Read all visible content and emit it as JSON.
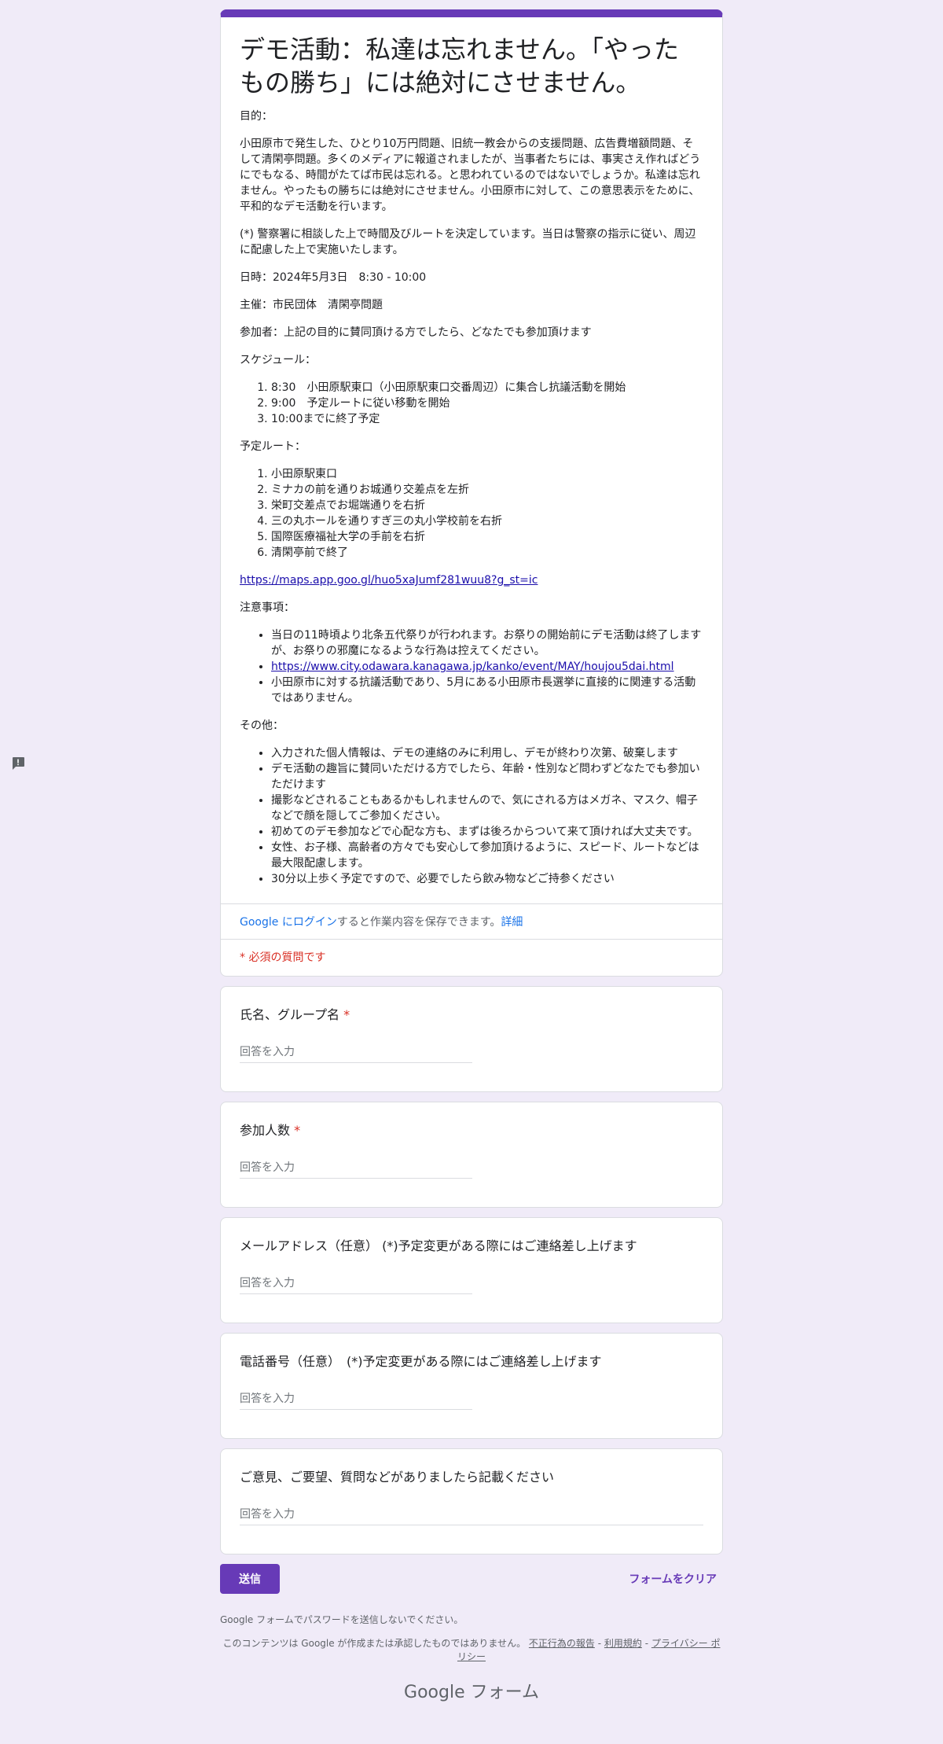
{
  "form": {
    "title": "デモ活動：私達は忘れません。「やったもの勝ち」には絶対にさせません。",
    "accent": "#673ab7",
    "purpose_heading": "目的：",
    "purpose_text": "小田原市で発生した、ひとり10万円問題、旧統一教会からの支援問題、広告費増額問題、そして清閑亭問題。多くのメディアに報道されましたが、当事者たちには、事実さえ作ればどうにでもなる、時間がたてば市民は忘れる。と思われているのではないでしょうか。私達は忘れません。やったもの勝ちには絶対にさせません。小田原市に対して、この意思表示をために、平和的なデモ活動を行います。",
    "police_note": "(*) 警察署に相談した上で時間及びルートを決定しています。当日は警察の指示に従い、周辺に配慮した上で実施いたします。",
    "datetime": "日時：2024年5月3日　8:30 - 10:00",
    "organizer": "主催：市民団体　清閑亭問題",
    "participants": "参加者：上記の目的に賛同頂ける方でしたら、どなたでも参加頂けます",
    "schedule_heading": "スケジュール：",
    "schedule": [
      "8:30　小田原駅東口（小田原駅東口交番周辺）に集合し抗議活動を開始",
      "9:00　予定ルートに従い移動を開始",
      "10:00までに終了予定"
    ],
    "route_heading": "予定ルート：",
    "route": [
      "小田原駅東口",
      "ミナカの前を通りお城通り交差点を左折",
      "栄町交差点でお堀端通りを右折",
      "三の丸ホールを通りすぎ三の丸小学校前を右折",
      "国際医療福祉大学の手前を右折",
      "清閑亭前で終了"
    ],
    "map_link": "https://maps.app.goo.gl/huo5xaJumf281wuu8?g_st=ic",
    "notes_heading": "注意事項：",
    "notes": [
      {
        "text": "当日の11時頃より北条五代祭りが行われます。お祭りの開始前にデモ活動は終了しますが、お祭りの邪魔になるような行為は控えてください。",
        "link": false
      },
      {
        "text": "https://www.city.odawara.kanagawa.jp/kanko/event/MAY/houjou5dai.html",
        "link": true
      },
      {
        "text": "小田原市に対する抗議活動であり、5月にある小田原市長選挙に直接的に関連する活動ではありません。",
        "link": false
      }
    ],
    "other_heading": "その他：",
    "other": [
      "入力された個人情報は、デモの連絡のみに利用し、デモが終わり次第、破棄します",
      "デモ活動の趣旨に賛同いただける方でしたら、年齢・性別など問わずどなたでも参加いただけます",
      "撮影などされることもあるかもしれませんので、気にされる方はメガネ、マスク、帽子などで顔を隠してご参加ください。",
      "初めてのデモ参加などで心配な方も、まずは後ろからついて来て頂ければ大丈夫です。",
      "女性、お子様、高齢者の方々でも安心して参加頂けるように、スピード、ルートなどは最大限配慮します。",
      "30分以上歩く予定ですので、必要でしたら飲み物などご持参ください"
    ],
    "login_link": "Google にログイン",
    "login_text": "すると作業内容を保存できます。",
    "login_more": "詳細",
    "required_note": "* 必須の質問です"
  },
  "questions": [
    {
      "label": "氏名、グループ名",
      "required": true,
      "placeholder": "回答を入力"
    },
    {
      "label": "参加人数",
      "required": true,
      "placeholder": "回答を入力"
    },
    {
      "label": "メールアドレス（任意） (*)予定変更がある際にはご連絡差し上げます",
      "required": false,
      "placeholder": "回答を入力"
    },
    {
      "label": "電話番号（任意）　(*)予定変更がある際にはご連絡差し上げます",
      "required": false,
      "placeholder": "回答を入力"
    },
    {
      "label": "ご意見、ご要望、質問などがありましたら記載ください",
      "required": false,
      "placeholder": "回答を入力"
    }
  ],
  "actions": {
    "submit": "送信",
    "clear": "フォームをクリア"
  },
  "footer": {
    "password_note": "Google フォームでパスワードを送信しないでください。",
    "disclaimer": "このコンテンツは Google が作成または承認したものではありません。",
    "report": "不正行為の報告",
    "terms": "利用規約",
    "privacy": "プライバシー ポリシー",
    "sep": "-",
    "brand": "Google フォーム"
  }
}
